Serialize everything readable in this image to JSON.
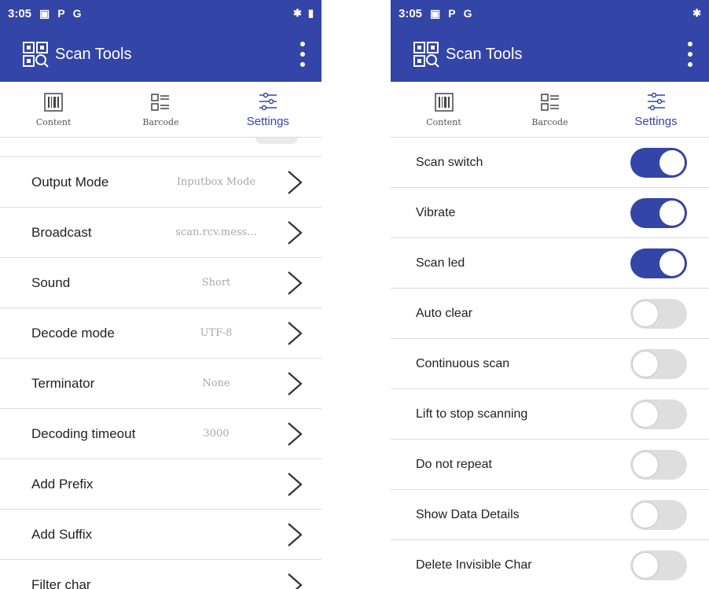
{
  "colors": {
    "brand": "#3345a6",
    "toggle_off": "#dedede",
    "value_text": "#a8a8a8"
  },
  "status_bar": {
    "time": "3:05",
    "icons": [
      "image-icon",
      "parking-icon",
      "g-icon"
    ],
    "right_icons": [
      "bluetooth-icon",
      "battery-icon"
    ]
  },
  "app_bar": {
    "title": "Scan Tools",
    "app_icon": "qr-scan-icon",
    "menu_icon": "more-vert-icon"
  },
  "tabs": [
    {
      "label": "Content",
      "icon": "barcode-icon"
    },
    {
      "label": "Barcode",
      "icon": "list-icon"
    },
    {
      "label": "Settings",
      "icon": "sliders-icon",
      "active": true
    }
  ],
  "left_settings": [
    {
      "label": "Output Mode",
      "value": "Inputbox Mode"
    },
    {
      "label": "Broadcast",
      "value": "scan.rcv.mess..."
    },
    {
      "label": "Sound",
      "value": "Short"
    },
    {
      "label": "Decode mode",
      "value": "UTF-8"
    },
    {
      "label": "Terminator",
      "value": "None"
    },
    {
      "label": "Decoding timeout",
      "value": "3000"
    },
    {
      "label": "Add Prefix",
      "value": ""
    },
    {
      "label": "Add Suffix",
      "value": ""
    },
    {
      "label": "Filter char",
      "value": ""
    }
  ],
  "right_settings": [
    {
      "label": "Scan switch",
      "enabled": true
    },
    {
      "label": "Vibrate",
      "enabled": true
    },
    {
      "label": "Scan led",
      "enabled": true
    },
    {
      "label": "Auto clear",
      "enabled": false
    },
    {
      "label": "Continuous scan",
      "enabled": false
    },
    {
      "label": "Lift to stop scanning",
      "enabled": false
    },
    {
      "label": "Do not repeat",
      "enabled": false
    },
    {
      "label": "Show Data Details",
      "enabled": false
    },
    {
      "label": "Delete Invisible Char",
      "enabled": false
    }
  ]
}
